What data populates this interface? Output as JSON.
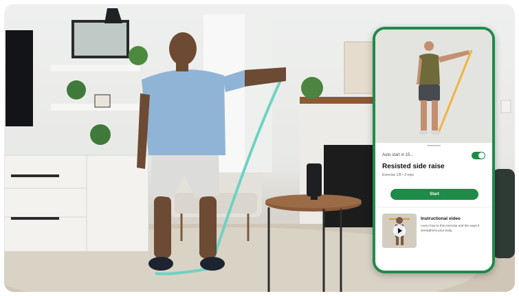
{
  "phone_app": {
    "autostart_label": "Auto start in 15...",
    "autostart_enabled": true,
    "exercise_title": "Resisted side raise",
    "exercise_meta": "Exercise 1/8 • 3 reps",
    "start_label": "Start",
    "instructional_video": {
      "title": "Instructional video",
      "description": "Learn how to this exercise and the ways it strengthens your body."
    }
  },
  "colors": {
    "accent_green": "#1e8b48",
    "resistance_band": "#6fd2c3",
    "phone_band": "#f1b33c"
  },
  "icons": [
    "play-icon",
    "toggle-switch"
  ]
}
